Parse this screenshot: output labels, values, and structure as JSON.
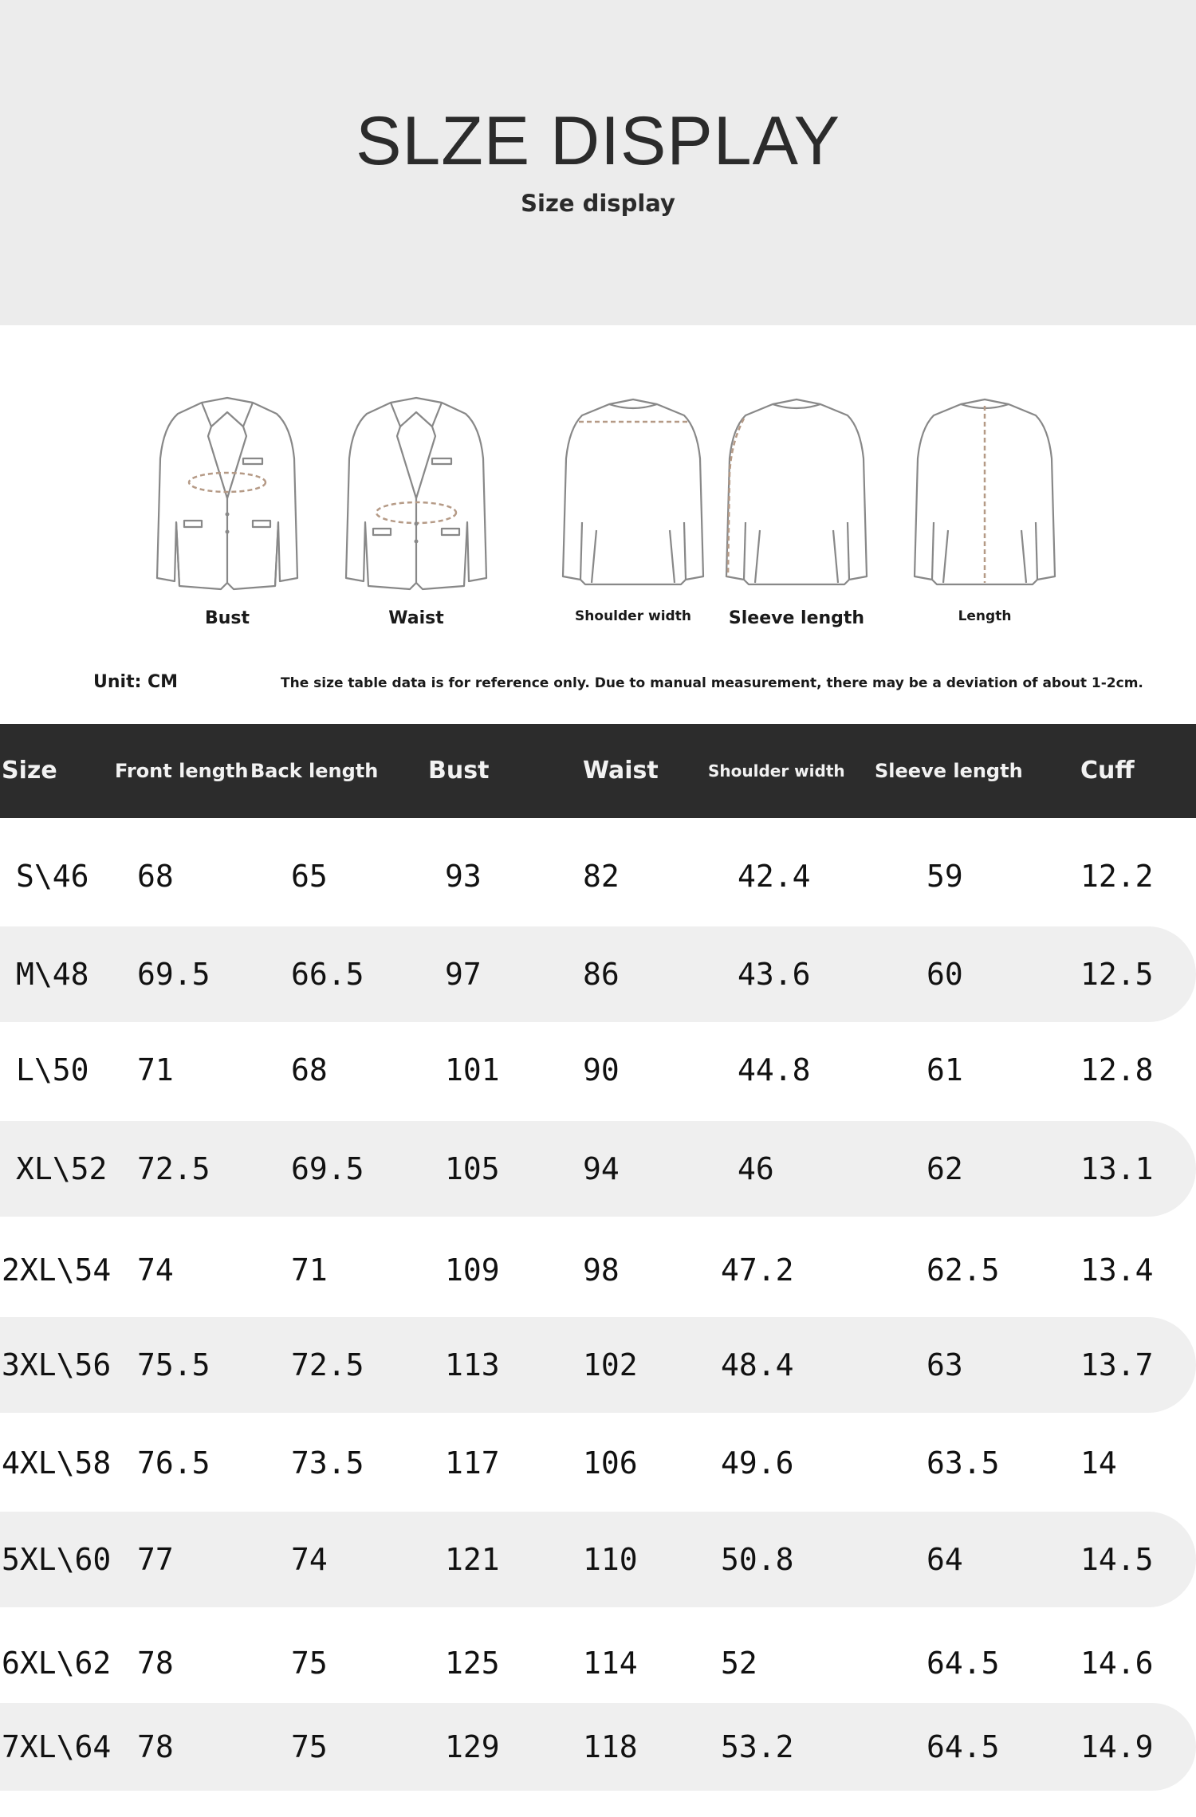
{
  "header": {
    "title": "SLZE DISPLAY",
    "subtitle": "Size display"
  },
  "figures": [
    {
      "label": "Bust"
    },
    {
      "label": "Waist"
    },
    {
      "label": "Shoulder width"
    },
    {
      "label": "Sleeve length"
    },
    {
      "label": "Length"
    }
  ],
  "unit": "Unit: CM",
  "note": "The size table data is for reference only. Due to manual measurement, there may be a deviation of about 1-2cm.",
  "table": {
    "headers": [
      "Size",
      "Front length",
      "Back length",
      "Bust",
      "Waist",
      "Shoulder width",
      "Sleeve length",
      "Cuff"
    ],
    "rows": [
      [
        "S\\46",
        "68",
        "65",
        "93",
        "82",
        "42.4",
        "59",
        "12.2"
      ],
      [
        "M\\48",
        "69.5",
        "66.5",
        "97",
        "86",
        "43.6",
        "60",
        "12.5"
      ],
      [
        "L\\50",
        "71",
        "68",
        "101",
        "90",
        "44.8",
        "61",
        "12.8"
      ],
      [
        "XL\\52",
        "72.5",
        "69.5",
        "105",
        "94",
        "46",
        "62",
        "13.1"
      ],
      [
        "2XL\\54",
        "74",
        "71",
        "109",
        "98",
        "47.2",
        "62.5",
        "13.4"
      ],
      [
        "3XL\\56",
        "75.5",
        "72.5",
        "113",
        "102",
        "48.4",
        "63",
        "13.7"
      ],
      [
        "4XL\\58",
        "76.5",
        "73.5",
        "117",
        "106",
        "49.6",
        "63.5",
        "14"
      ],
      [
        "5XL\\60",
        "77",
        "74",
        "121",
        "110",
        "50.8",
        "64",
        "14.5"
      ],
      [
        "6XL\\62",
        "78",
        "75",
        "125",
        "114",
        "52",
        "64.5",
        "14.6"
      ],
      [
        "7XL\\64",
        "78",
        "75",
        "129",
        "118",
        "53.2",
        "64.5",
        "14.9"
      ]
    ]
  }
}
